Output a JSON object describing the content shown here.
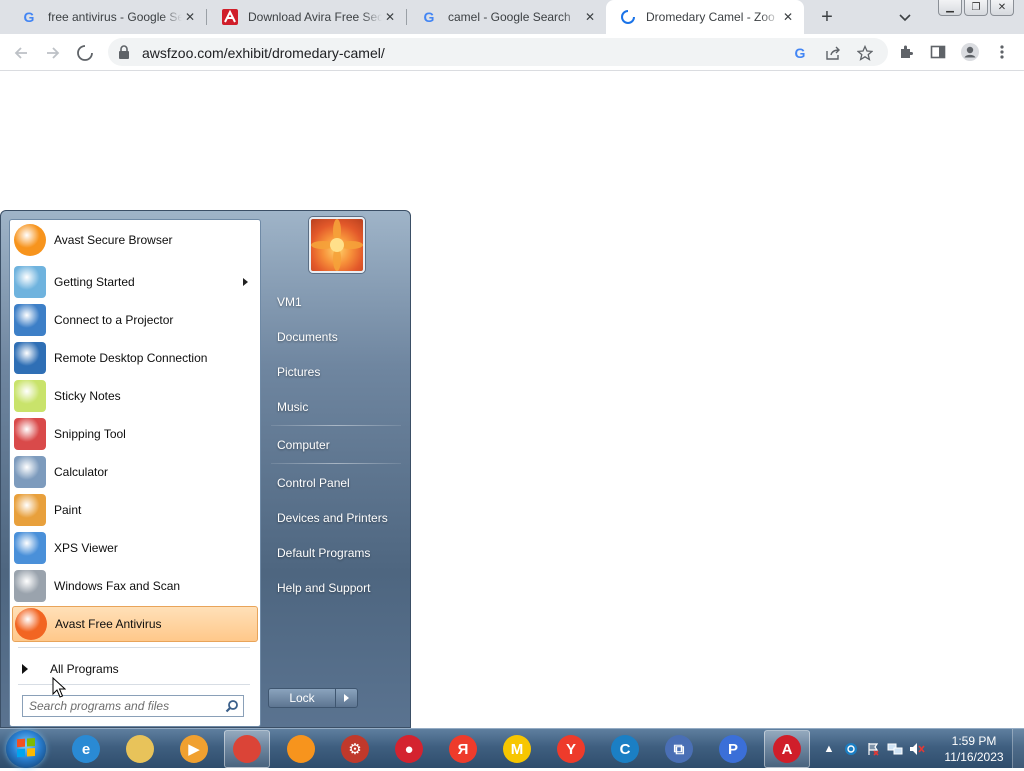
{
  "browser": {
    "tabs": [
      {
        "title": "free antivirus - Google Search",
        "favicon": "google-icon"
      },
      {
        "title": "Download Avira Free Security",
        "favicon": "avira-icon"
      },
      {
        "title": "camel - Google Search",
        "favicon": "google-icon"
      },
      {
        "title": "Dromedary Camel - Zoo",
        "favicon": "loading-spinner-icon",
        "active": true
      }
    ],
    "close_glyph": "✕",
    "new_tab_glyph": "+",
    "url": "awsfzoo.com/exhibit/dromedary-camel/"
  },
  "start_menu": {
    "programs": [
      {
        "label": "Avast Secure Browser",
        "icon": "avast-secure-browser-icon",
        "color": "#f7941d"
      },
      {
        "label": "Getting Started",
        "icon": "getting-started-icon",
        "color": "#6fb3de",
        "submenu": true
      },
      {
        "label": "Connect to a Projector",
        "icon": "projector-icon",
        "color": "#3d7fc7"
      },
      {
        "label": "Remote Desktop Connection",
        "icon": "remote-desktop-icon",
        "color": "#2f6fb5"
      },
      {
        "label": "Sticky Notes",
        "icon": "sticky-notes-icon",
        "color": "#c9e36b"
      },
      {
        "label": "Snipping Tool",
        "icon": "snipping-tool-icon",
        "color": "#d94a4a"
      },
      {
        "label": "Calculator",
        "icon": "calculator-icon",
        "color": "#7d9bbd"
      },
      {
        "label": "Paint",
        "icon": "paint-icon",
        "color": "#e8a03c"
      },
      {
        "label": "XPS Viewer",
        "icon": "xps-viewer-icon",
        "color": "#4a90d9"
      },
      {
        "label": "Windows Fax and Scan",
        "icon": "fax-scan-icon",
        "color": "#9aa3ad"
      },
      {
        "label": "Avast Free Antivirus",
        "icon": "avast-antivirus-icon",
        "color": "#f26522",
        "highlighted": true
      }
    ],
    "all_programs": "All Programs",
    "search_placeholder": "Search programs and files",
    "right_links": [
      {
        "label": "VM1"
      },
      {
        "label": "Documents"
      },
      {
        "label": "Pictures"
      },
      {
        "label": "Music"
      },
      {
        "label": "Computer"
      },
      {
        "label": "Control Panel"
      },
      {
        "label": "Devices and Printers"
      },
      {
        "label": "Default Programs"
      },
      {
        "label": "Help and Support"
      }
    ],
    "lock_label": "Lock"
  },
  "taskbar": {
    "pinned": [
      {
        "name": "internet-explorer-icon",
        "color": "#2a8ad4",
        "glyph": "e"
      },
      {
        "name": "file-explorer-icon",
        "color": "#e8c35a",
        "glyph": ""
      },
      {
        "name": "media-player-icon",
        "color": "#f0a030",
        "glyph": "▶"
      },
      {
        "name": "chrome-icon",
        "color": "#db4437",
        "glyph": "",
        "active": true
      },
      {
        "name": "avast-browser-icon",
        "color": "#f7941d",
        "glyph": ""
      },
      {
        "name": "avast-app-icon",
        "color": "#c0392b",
        "glyph": "⚙"
      },
      {
        "name": "screen-recorder-icon",
        "color": "#d4232f",
        "glyph": "●"
      },
      {
        "name": "yandex-browser-icon",
        "color": "#ee3b2b",
        "glyph": "Я"
      },
      {
        "name": "yandex-music-icon",
        "color": "#f7c600",
        "glyph": "M"
      },
      {
        "name": "yandex-icon",
        "color": "#ee3b2b",
        "glyph": "Y"
      },
      {
        "name": "ccleaner-icon",
        "color": "#1b7fc4",
        "glyph": "C"
      },
      {
        "name": "remote-app-icon",
        "color": "#4a6fb5",
        "glyph": "⧉"
      },
      {
        "name": "p-app-icon",
        "color": "#3b6fd8",
        "glyph": "P"
      },
      {
        "name": "avira-icon",
        "color": "#d01e2a",
        "glyph": "A",
        "active": true
      }
    ],
    "clock_time": "1:59 PM",
    "clock_date": "11/16/2023"
  }
}
